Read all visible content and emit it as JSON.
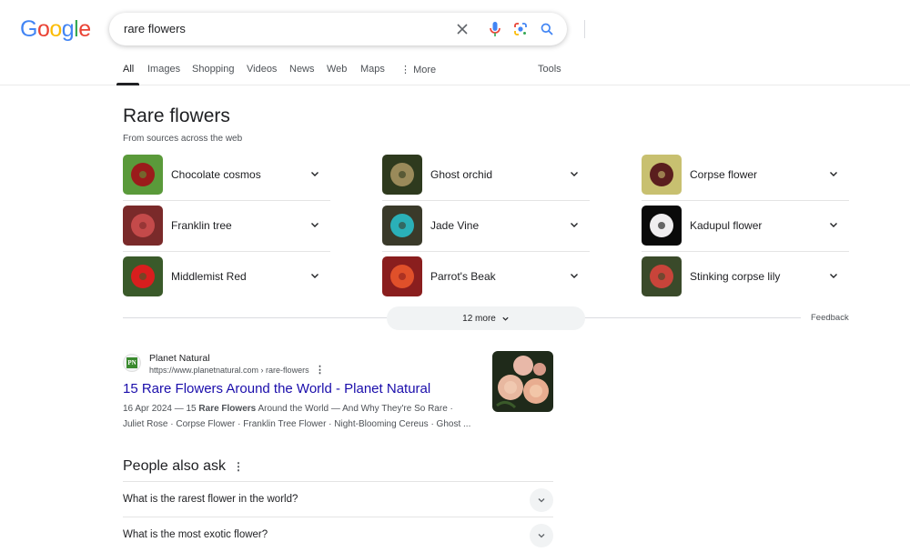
{
  "header": {
    "logo_letters": [
      {
        "ch": "G",
        "color": "#4285F4"
      },
      {
        "ch": "o",
        "color": "#EA4335"
      },
      {
        "ch": "o",
        "color": "#FBBC05"
      },
      {
        "ch": "g",
        "color": "#4285F4"
      },
      {
        "ch": "l",
        "color": "#34A853"
      },
      {
        "ch": "e",
        "color": "#EA4335"
      }
    ],
    "search_query": "rare flowers"
  },
  "tabs": {
    "all": "All",
    "images": "Images",
    "shopping": "Shopping",
    "videos": "Videos",
    "news": "News",
    "web": "Web",
    "maps": "Maps",
    "more": "More",
    "tools": "Tools"
  },
  "section": {
    "title": "Rare flowers",
    "subtitle": "From sources across the web",
    "items": [
      {
        "name": "Chocolate cosmos",
        "thumb_colors": [
          "#5a9a3a",
          "#9b1b1b"
        ]
      },
      {
        "name": "Ghost orchid",
        "thumb_colors": [
          "#2e3a1e",
          "#9a8a5a"
        ]
      },
      {
        "name": "Corpse flower",
        "thumb_colors": [
          "#c8c070",
          "#5a1e1e"
        ]
      },
      {
        "name": "Franklin tree",
        "thumb_colors": [
          "#7a2a2a",
          "#c44a4a"
        ]
      },
      {
        "name": "Jade Vine",
        "thumb_colors": [
          "#3a3a2a",
          "#2ab0b8"
        ]
      },
      {
        "name": "Kadupul flower",
        "thumb_colors": [
          "#0a0a0a",
          "#f0eef0"
        ]
      },
      {
        "name": "Middlemist Red",
        "thumb_colors": [
          "#3a5a2a",
          "#d81e1e"
        ]
      },
      {
        "name": "Parrot's Beak",
        "thumb_colors": [
          "#8a1e1e",
          "#e0502a"
        ]
      },
      {
        "name": "Stinking corpse lily",
        "thumb_colors": [
          "#3a4a2a",
          "#c8443a"
        ]
      }
    ],
    "more_label": "12 more",
    "feedback_label": "Feedback"
  },
  "result": {
    "site_name": "Planet Natural",
    "favicon_text": "PN",
    "url": "https://www.planetnatural.com › rare-flowers",
    "title": "15 Rare Flowers Around the World - Planet Natural",
    "snippet_date": "16 Apr 2024 — 15 ",
    "snippet_bold": "Rare Flowers",
    "snippet_rest": " Around the World — And Why They're So Rare ·",
    "snippet_line2": "Juliet Rose · Corpse Flower · Franklin Tree Flower · Night-Blooming Cereus · Ghost ..."
  },
  "paa": {
    "title": "People also ask",
    "questions": [
      "What is the rarest flower in the world?",
      "What is the most exotic flower?"
    ]
  }
}
